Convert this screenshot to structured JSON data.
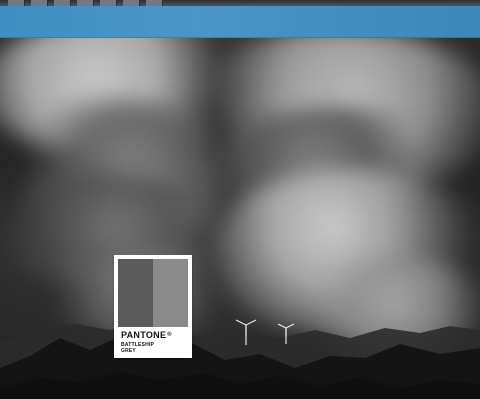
{
  "pantone_card": {
    "brand": "PANTONE",
    "brand_mark": "®",
    "color_name_line1": "BATTLESHIP",
    "color_name_line2": "GREY"
  },
  "colors": {
    "header_blue": "#3f8fc2",
    "card_white": "#ffffff",
    "swatch_dark": "#5a5a5a",
    "swatch_light": "#8a8a8a"
  }
}
